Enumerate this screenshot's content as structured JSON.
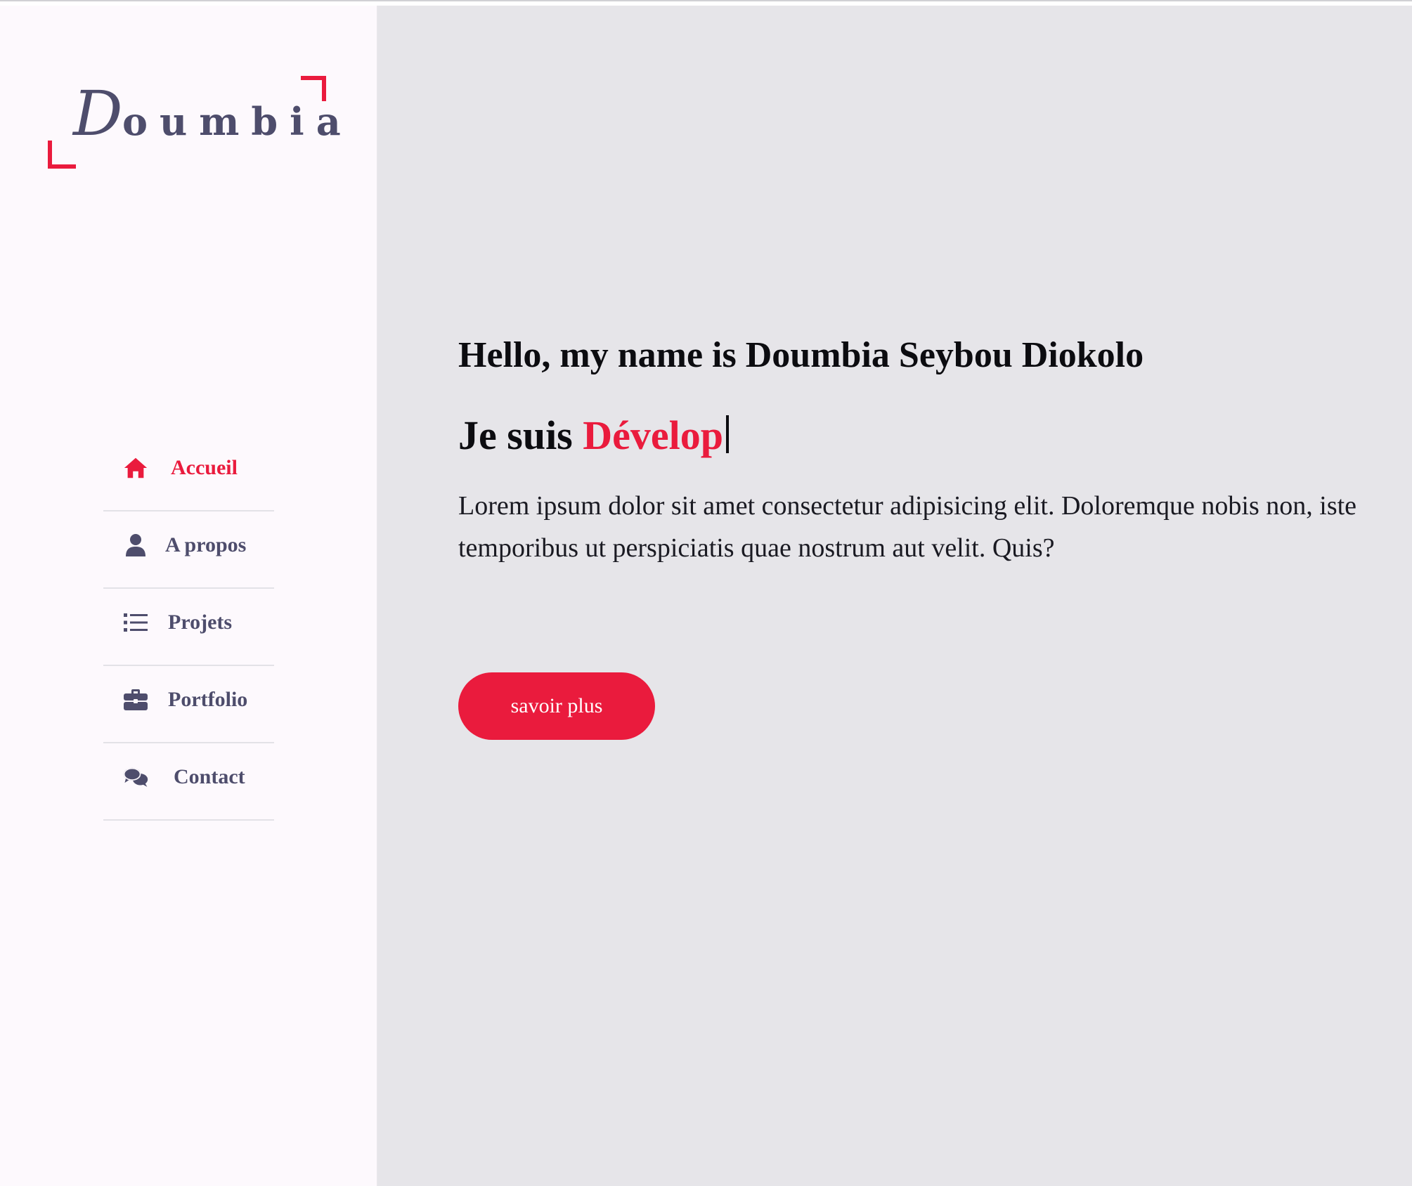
{
  "brand": {
    "logo_initial": "D",
    "logo_rest": "oumbia",
    "accent_color": "#ea1b3d",
    "text_color": "#4e4d6c"
  },
  "nav": {
    "items": [
      {
        "label": "Accueil",
        "icon": "home-icon",
        "active": true
      },
      {
        "label": "A propos",
        "icon": "user-icon",
        "active": false
      },
      {
        "label": "Projets",
        "icon": "list-icon",
        "active": false
      },
      {
        "label": "Portfolio",
        "icon": "briefcase-icon",
        "active": false
      },
      {
        "label": "Contact",
        "icon": "comments-icon",
        "active": false
      }
    ]
  },
  "hero": {
    "greeting": "Hello, my name is Doumbia Seybou Diokolo",
    "role_prefix": "Je suis ",
    "role_typed": "Dévelop",
    "description": "Lorem ipsum dolor sit amet consectetur adipisicing elit. Doloremque nobis non, iste temporibus ut perspiciatis quae nostrum aut velit. Quis?",
    "button_label": "savoir plus"
  }
}
